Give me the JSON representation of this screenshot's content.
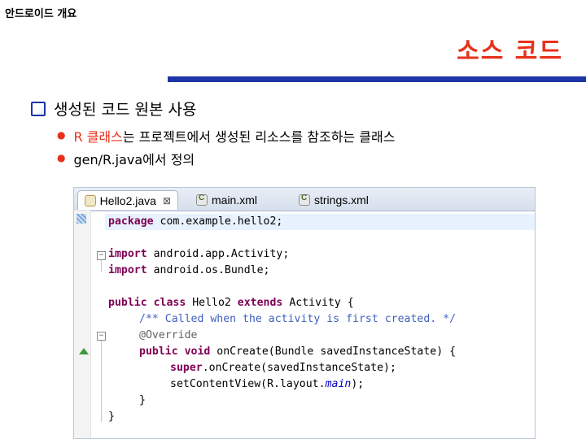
{
  "header": {
    "small_title": "안드로이드 개요",
    "slide_title": "소스 코드"
  },
  "bullets": {
    "main": "생성된 코드 원본 사용",
    "sub1_red": "R 클래스",
    "sub1_rest": "는 프로젝트에서 생성된 리소스를 참조하는 클래스",
    "sub2": "gen/R.java에서 정의"
  },
  "editor": {
    "tabs": [
      {
        "label": "Hello2.java",
        "close": "⊠"
      },
      {
        "label": "main.xml"
      },
      {
        "label": "strings.xml"
      }
    ],
    "code": {
      "l1_kw": "package",
      "l1_rest": " com.example.hello2;",
      "l2_kw": "import",
      "l2_rest": " android.app.Activity;",
      "l3_kw": "import",
      "l3_rest": " android.os.Bundle;",
      "l4_kw1": "public",
      "l4_kw2": " class",
      "l4_mid": " Hello2",
      "l4_kw3": " extends",
      "l4_rest": " Activity {",
      "l5_comment": "/** Called when the activity is first created. */",
      "l6_annotation": "@Override",
      "l7_kw1": "public",
      "l7_kw2": " void",
      "l7_rest": " onCreate(Bundle savedInstanceState) {",
      "l8_kw": "super",
      "l8_rest": ".onCreate(savedInstanceState);",
      "l9_pre": "setContentView(R.layout.",
      "l9_field": "main",
      "l9_post": ");",
      "l10": "}",
      "l11": "}"
    }
  }
}
